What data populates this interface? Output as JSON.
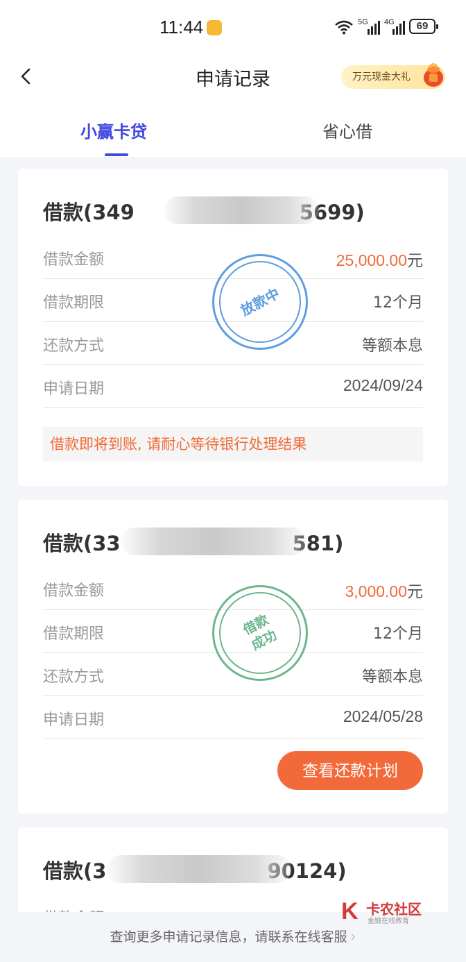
{
  "status_bar": {
    "time": "11:44",
    "battery": "69",
    "net1": "5G",
    "net2": "4G"
  },
  "header": {
    "title": "申请记录",
    "promo": "万元现金大礼",
    "tabs": [
      {
        "label": "小赢卡贷",
        "active": true
      },
      {
        "label": "省心借",
        "active": false
      }
    ]
  },
  "cards": [
    {
      "title_prefix": "借款(349",
      "title_suffix": "5699)",
      "rows": [
        {
          "label": "借款金额",
          "amount": "25,000.00",
          "unit": "元"
        },
        {
          "label": "借款期限",
          "value": "12个月"
        },
        {
          "label": "还款方式",
          "value": "等额本息"
        },
        {
          "label": "申请日期",
          "value": "2024/09/24"
        }
      ],
      "stamp": "放款中",
      "notice": "借款即将到账, 请耐心等待银行处理结果"
    },
    {
      "title_prefix": "借款(33",
      "title_suffix": "581)",
      "rows": [
        {
          "label": "借款金额",
          "amount": "3,000.00",
          "unit": "元"
        },
        {
          "label": "借款期限",
          "value": "12个月"
        },
        {
          "label": "还款方式",
          "value": "等额本息"
        },
        {
          "label": "申请日期",
          "value": "2024/05/28"
        }
      ],
      "stamp_line1": "借款",
      "stamp_line2": "成功",
      "button": "查看还款计划"
    },
    {
      "title_prefix": "借款(3",
      "title_suffix": "90124)",
      "rows": [
        {
          "label": "借款金额"
        }
      ]
    }
  ],
  "footer": {
    "text": "查询更多申请记录信息，请联系在线客服"
  },
  "watermark": {
    "title": "卡农社区",
    "subtitle": "金融在线教育"
  },
  "colors": {
    "accent": "#4148e0",
    "orange": "#f06a35",
    "stamp_blue": "#5d9de0",
    "stamp_green": "#6cb68c"
  }
}
